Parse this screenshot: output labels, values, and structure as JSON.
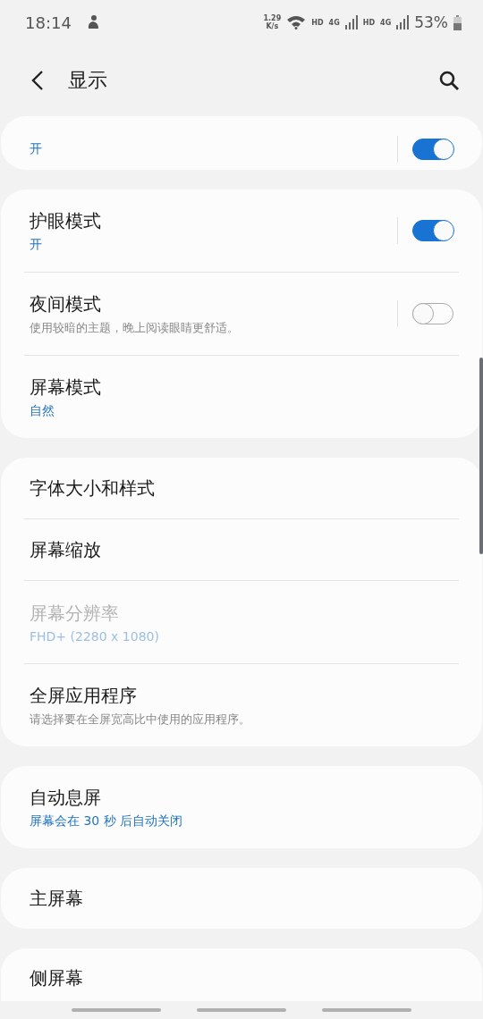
{
  "status_bar": {
    "time": "18:14",
    "speed": [
      "1.29",
      "K/s"
    ],
    "network_labels": [
      "HD",
      "4G",
      "HD",
      "4G"
    ],
    "battery": "53%"
  },
  "header": {
    "title": "显示"
  },
  "groups": [
    {
      "items": [
        {
          "kind": "switch",
          "value": "开",
          "on": true,
          "disabled": false
        }
      ]
    },
    {
      "items": [
        {
          "kind": "switch",
          "title": "护眼模式",
          "value": "开",
          "on": true,
          "disabled": false
        },
        {
          "kind": "switch",
          "title": "夜间模式",
          "description": "使用较暗的主题，晚上阅读眼睛更舒适。",
          "on": false,
          "disabled": false
        },
        {
          "kind": "plain",
          "title": "屏幕模式",
          "value": "自然",
          "disabled": false
        }
      ]
    },
    {
      "items": [
        {
          "kind": "plain",
          "title": "字体大小和样式",
          "disabled": false
        },
        {
          "kind": "plain",
          "title": "屏幕缩放",
          "disabled": false
        },
        {
          "kind": "plain",
          "title": "屏幕分辨率",
          "value": "FHD+ (2280 x 1080)",
          "disabled": true
        },
        {
          "kind": "plain",
          "title": "全屏应用程序",
          "description": "请选择要在全屏宽高比中使用的应用程序。",
          "disabled": false
        }
      ]
    },
    {
      "items": [
        {
          "kind": "plain",
          "title": "自动息屏",
          "value": "屏幕会在 30 秒 后自动关闭",
          "disabled": false
        }
      ]
    },
    {
      "items": [
        {
          "kind": "plain",
          "title": "主屏幕",
          "disabled": false
        }
      ]
    },
    {
      "items": [
        {
          "kind": "plain",
          "title": "侧屏幕",
          "disabled": false
        }
      ]
    }
  ]
}
